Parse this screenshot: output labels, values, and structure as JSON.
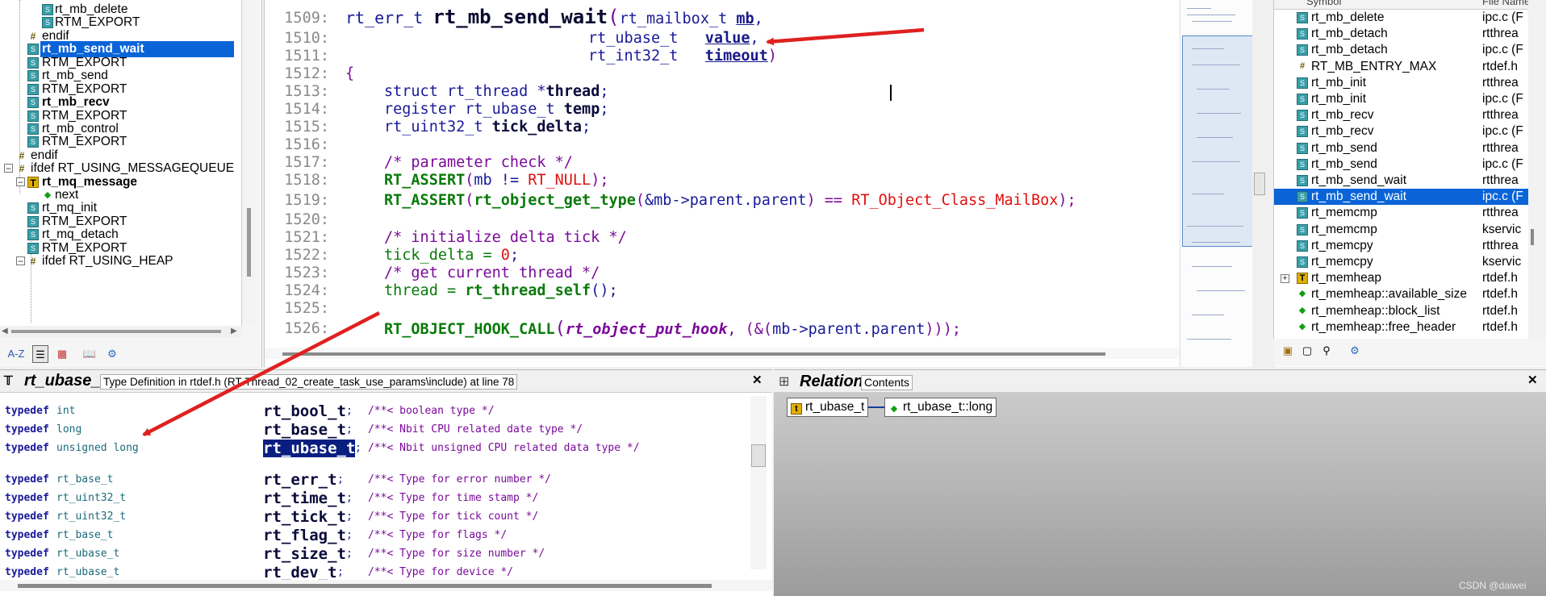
{
  "tree": {
    "items": [
      {
        "label": "rt_mb_delete",
        "icon": "s",
        "bold": false
      },
      {
        "label": "RTM_EXPORT",
        "icon": "s",
        "bold": false
      },
      {
        "label": "endif",
        "icon": "hash",
        "bold": false
      },
      {
        "label": "rt_mb_send_wait",
        "icon": "s",
        "bold": true,
        "selected": true
      },
      {
        "label": "RTM_EXPORT",
        "icon": "s",
        "bold": false
      },
      {
        "label": "rt_mb_send",
        "icon": "s",
        "bold": false
      },
      {
        "label": "RTM_EXPORT",
        "icon": "s",
        "bold": false
      },
      {
        "label": "rt_mb_recv",
        "icon": "s",
        "bold": true
      },
      {
        "label": "RTM_EXPORT",
        "icon": "s",
        "bold": false
      },
      {
        "label": "rt_mb_control",
        "icon": "s",
        "bold": false
      },
      {
        "label": "RTM_EXPORT",
        "icon": "s",
        "bold": false
      },
      {
        "label": "endif",
        "icon": "hash",
        "bold": false
      },
      {
        "label": "ifdef RT_USING_MESSAGEQUEUE",
        "icon": "hash",
        "bold": false
      },
      {
        "label": "rt_mq_message",
        "icon": "tt",
        "bold": true
      },
      {
        "label": "next",
        "icon": "diamond",
        "bold": false
      },
      {
        "label": "rt_mq_init",
        "icon": "s",
        "bold": false
      },
      {
        "label": "RTM_EXPORT",
        "icon": "s",
        "bold": false
      },
      {
        "label": "rt_mq_detach",
        "icon": "s",
        "bold": false
      },
      {
        "label": "RTM_EXPORT",
        "icon": "s",
        "bold": false
      },
      {
        "label": "ifdef RT_USING_HEAP",
        "icon": "hash",
        "bold": false
      }
    ],
    "toolbar_sort_label": "A-Z"
  },
  "editor": {
    "line_numbers": [
      "1509:",
      "1510:",
      "1511:",
      "1512:",
      "1513:",
      "1514:",
      "1515:",
      "1516:",
      "1517:",
      "1518:",
      "1519:",
      "1520:",
      "1521:",
      "1522:",
      "1523:",
      "1524:",
      "1525:",
      "1526:"
    ],
    "l1509": {
      "t1": "rt_err_t ",
      "t2": "rt_mb_send_wait",
      "t3": "(",
      "t4": "rt_mailbox_t ",
      "t5": "mb",
      "t6": ","
    },
    "l1510": {
      "t1": "rt_ubase_t   ",
      "t2": "value",
      "t3": ","
    },
    "l1511": {
      "t1": "rt_int32_t   ",
      "t2": "timeout",
      "t3": ")"
    },
    "l1512": {
      "t1": "{"
    },
    "l1513": {
      "t1": "struct ",
      "t2": "rt_thread ",
      "t3": "*",
      "t4": "thread",
      "t5": ";"
    },
    "l1514": {
      "t1": "register ",
      "t2": "rt_ubase_t ",
      "t3": "temp",
      "t4": ";"
    },
    "l1515": {
      "t1": "rt_uint32_t ",
      "t2": "tick_delta",
      "t3": ";"
    },
    "l1517": {
      "t1": "/* parameter check */"
    },
    "l1518": {
      "t1": "RT_ASSERT",
      "t2": "(",
      "t3": "mb != ",
      "t4": "RT_NULL",
      "t5": ");"
    },
    "l1519": {
      "t1": "RT_ASSERT",
      "t2": "(",
      "t3": "rt_object_get_type",
      "t4": "(",
      "t5": "&mb->parent.parent",
      "t6": ") == ",
      "t7": "RT_Object_Class_MailBox",
      "t8": ");"
    },
    "l1521": {
      "t1": "/* initialize delta tick */"
    },
    "l1522": {
      "t1": "tick_delta = ",
      "t2": "0",
      "t3": ";"
    },
    "l1523": {
      "t1": "/* get current thread */"
    },
    "l1524": {
      "t1": "thread = ",
      "t2": "rt_thread_self",
      "t3": "();"
    },
    "l1526": {
      "t1": "RT_OBJECT_HOOK_CALL",
      "t2": "(",
      "t3": "rt_object_put_hook",
      "t4": ", (&(",
      "t5": "mb->parent.parent",
      "t6": ")));"
    }
  },
  "symbols": {
    "header": "Symbol",
    "header_file": "File Name",
    "rows": [
      {
        "name": "rt_mb_delete",
        "file": "ipc.c (F",
        "icon": "s"
      },
      {
        "name": "rt_mb_detach",
        "file": "rtthrea",
        "icon": "s"
      },
      {
        "name": "rt_mb_detach",
        "file": "ipc.c (F",
        "icon": "s"
      },
      {
        "name": "RT_MB_ENTRY_MAX",
        "file": "rtdef.h",
        "icon": "hash"
      },
      {
        "name": "rt_mb_init",
        "file": "rtthrea",
        "icon": "s"
      },
      {
        "name": "rt_mb_init",
        "file": "ipc.c (F",
        "icon": "s"
      },
      {
        "name": "rt_mb_recv",
        "file": "rtthrea",
        "icon": "s"
      },
      {
        "name": "rt_mb_recv",
        "file": "ipc.c (F",
        "icon": "s"
      },
      {
        "name": "rt_mb_send",
        "file": "rtthrea",
        "icon": "s"
      },
      {
        "name": "rt_mb_send",
        "file": "ipc.c (F",
        "icon": "s"
      },
      {
        "name": "rt_mb_send_wait",
        "file": "rtthrea",
        "icon": "s"
      },
      {
        "name": "rt_mb_send_wait",
        "file": "ipc.c (F",
        "icon": "s",
        "selected": true
      },
      {
        "name": "rt_memcmp",
        "file": "rtthrea",
        "icon": "s"
      },
      {
        "name": "rt_memcmp",
        "file": "kservic",
        "icon": "s"
      },
      {
        "name": "rt_memcpy",
        "file": "rtthrea",
        "icon": "s"
      },
      {
        "name": "rt_memcpy",
        "file": "kservic",
        "icon": "s"
      },
      {
        "name": "rt_memheap",
        "file": "rtdef.h",
        "icon": "tt",
        "expand": true
      },
      {
        "name": "rt_memheap::available_size",
        "file": "rtdef.h",
        "icon": "diamond"
      },
      {
        "name": "rt_memheap::block_list",
        "file": "rtdef.h",
        "icon": "diamond"
      },
      {
        "name": "rt_memheap::free_header",
        "file": "rtdef.h",
        "icon": "diamond"
      }
    ]
  },
  "context": {
    "symbol": "rt_ubase_t",
    "description": "Type Definition in rtdef.h (RT-Thread_02_create_task_use_params\\include) at line 78",
    "lines": [
      {
        "kw": "typedef",
        "base": "int",
        "name": "rt_bool_t",
        "sep": ";",
        "comment": "/**< boolean type */"
      },
      {
        "kw": "typedef",
        "base": "long",
        "name": "rt_base_t",
        "sep": ";",
        "comment": "/**< Nbit CPU related date type */"
      },
      {
        "kw": "typedef",
        "base": "unsigned long",
        "name": "rt_ubase_t",
        "sep": ";",
        "comment": "/**< Nbit unsigned CPU related data type */",
        "highlight": true
      },
      {
        "kw": "typedef",
        "base": "rt_base_t",
        "name": "rt_err_t",
        "sep": ";",
        "comment": "/**< Type for error number */"
      },
      {
        "kw": "typedef",
        "base": "rt_uint32_t",
        "name": "rt_time_t",
        "sep": ";",
        "comment": "/**< Type for time stamp */"
      },
      {
        "kw": "typedef",
        "base": "rt_uint32_t",
        "name": "rt_tick_t",
        "sep": ";",
        "comment": "/**< Type for tick count */"
      },
      {
        "kw": "typedef",
        "base": "rt_base_t",
        "name": "rt_flag_t",
        "sep": ";",
        "comment": "/**< Type for flags */"
      },
      {
        "kw": "typedef",
        "base": "rt_ubase_t",
        "name": "rt_size_t",
        "sep": ";",
        "comment": "/**< Type for size number */"
      },
      {
        "kw": "typedef",
        "base": "rt_ubase_t",
        "name": "rt_dev_t",
        "sep": ";",
        "comment": "/**< Type for device */"
      }
    ]
  },
  "relation": {
    "title": "Relation",
    "subtitle": "Contents",
    "node1": "rt_ubase_t",
    "node2": "rt_ubase_t::long"
  },
  "watermark": "CSDN @daiwei",
  "colors": {
    "selection": "#0a64d8",
    "annotation_arrow": "#e02020"
  }
}
